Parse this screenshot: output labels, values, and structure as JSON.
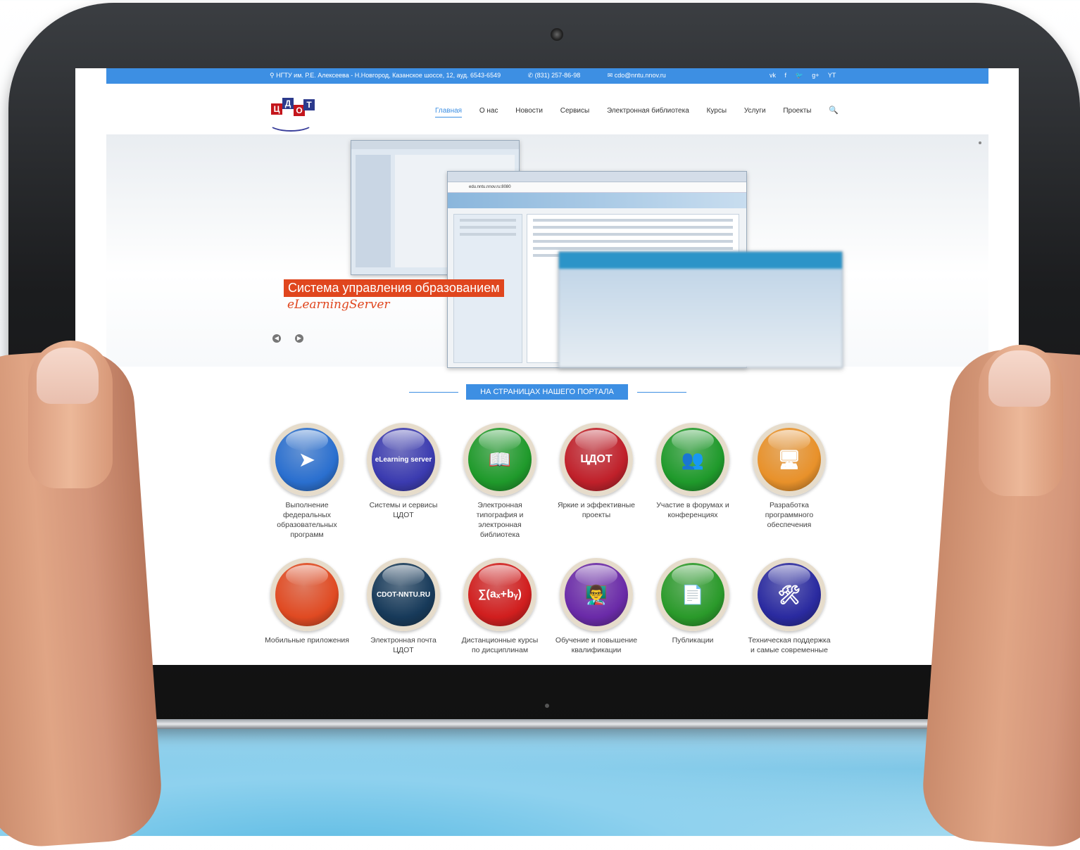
{
  "topbar": {
    "address": "НГТУ им. Р.Е. Алексеева - Н.Новгород, Казанское шоссе, 12, ауд. 6543-6549",
    "phone": "(831) 257-86-98",
    "email": "cdo@nntu.nnov.ru",
    "social": [
      "vk",
      "f",
      "twitter",
      "g+",
      "YT"
    ]
  },
  "logo": {
    "letters": [
      "Ц",
      "Д",
      "О",
      "Т"
    ]
  },
  "nav": {
    "items": [
      "Главная",
      "О нас",
      "Новости",
      "Сервисы",
      "Электронная библиотека",
      "Курсы",
      "Услуги",
      "Проекты"
    ],
    "active": "Главная"
  },
  "slider": {
    "title": "Система управления образованием",
    "subtitle": "eLearningServer",
    "browser_url": "edu.nntu.nnov.ru:8080"
  },
  "section": {
    "title": "НА СТРАНИЦАХ НАШЕГО ПОРТАЛА"
  },
  "tiles": [
    {
      "label": "Выполнение федеральных образовательных программ",
      "icon": "federal-programs-icon",
      "color": "#2a6fcf"
    },
    {
      "label": "Системы и сервисы ЦДОТ",
      "icon": "elearning-server-icon",
      "color": "#3b3bb0",
      "text": "eLearning server"
    },
    {
      "label": "Электронная типография и электронная библиотека",
      "icon": "open-book-icon",
      "color": "#1f9a2b"
    },
    {
      "label": "Яркие и эффективные проекты",
      "icon": "cdot-logo-icon",
      "color": "#c0202a"
    },
    {
      "label": "Участие в форумах и конференциях",
      "icon": "people-icon",
      "color": "#1f9a2b"
    },
    {
      "label": "Разработка программного обеспечения",
      "icon": "computer-icon",
      "color": "#e8912a"
    },
    {
      "label": "Мобильные приложения",
      "icon": "mobile-apps-icon",
      "color": "#e04a22"
    },
    {
      "label": "Электронная почта ЦДОТ",
      "icon": "email-login-icon",
      "color": "#173a5a",
      "text": "CDOT-NNTU.RU"
    },
    {
      "label": "Дистанционные курсы по дисциплинам",
      "icon": "sum-formula-icon",
      "color": "#d11e1e",
      "text": "∑(aₓ+bᵧ)"
    },
    {
      "label": "Обучение и повышение квалификации",
      "icon": "training-icon",
      "color": "#6a2aa8"
    },
    {
      "label": "Публикации",
      "icon": "publications-icon",
      "color": "#2a9a2a"
    },
    {
      "label": "Техническая поддержка и самые современные",
      "icon": "tools-icon",
      "color": "#2a2aa0"
    }
  ]
}
